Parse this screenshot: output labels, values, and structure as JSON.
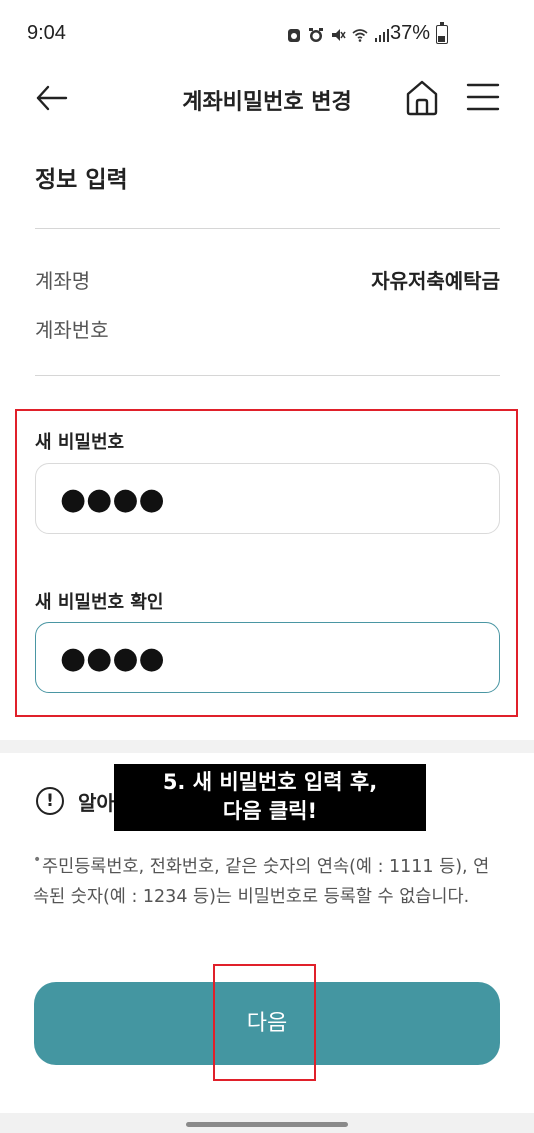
{
  "status_bar": {
    "time": "9:04",
    "battery": "37%",
    "battery_level": 0.37,
    "icons": [
      "notification-icon",
      "alarm-icon",
      "mute-icon",
      "wifi-icon",
      "signal-icon"
    ]
  },
  "header": {
    "title": "계좌비밀번호 변경",
    "back_icon": "arrow-left-icon",
    "home_icon": "home-icon",
    "menu_icon": "hamburger-menu-icon"
  },
  "section": {
    "title": "정보 입력"
  },
  "account": {
    "name_label": "계좌명",
    "name_value": "자유저축예탁금",
    "number_label": "계좌번호",
    "number_value": ""
  },
  "form": {
    "new_password_label": "새 비밀번호",
    "new_password_value": "●●●●",
    "confirm_password_label": "새 비밀번호 확인",
    "confirm_password_value": "●●●●"
  },
  "notice": {
    "icon": "exclamation-circle-icon",
    "title": "알아",
    "bullet": "•",
    "text": "주민등록번호, 전화번호, 같은 숫자의 연속(예 : 1111 등), 연속된 숫자(예 : 1234 등)는 비밀번호로 등록할 수 없습니다."
  },
  "overlay": {
    "line1": "5. 새 비밀번호 입력 후,",
    "line2": "다음 클릭!"
  },
  "next_button": {
    "label": "다음"
  },
  "colors": {
    "accent": "#4496a1",
    "highlight": "#e0202a",
    "active_border": "#4a96a3"
  }
}
